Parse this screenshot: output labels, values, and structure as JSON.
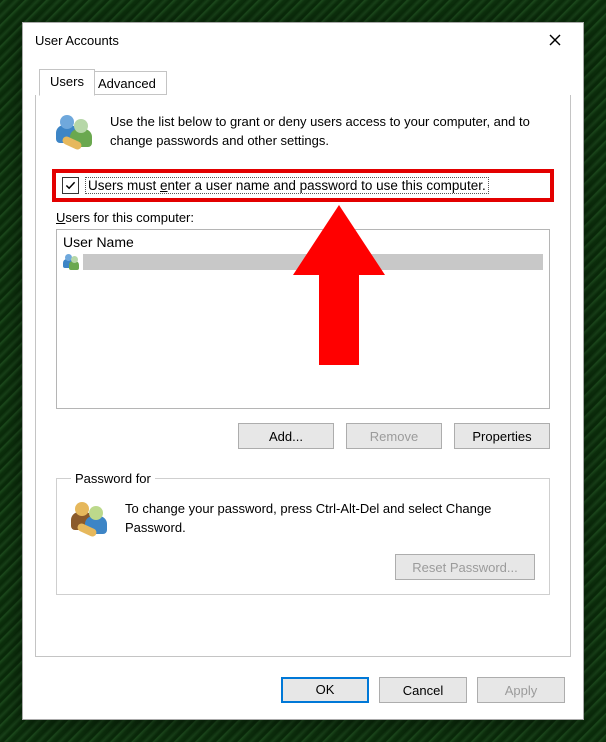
{
  "window": {
    "title": "User Accounts"
  },
  "tabs": {
    "users": "Users",
    "advanced": "Advanced"
  },
  "intro": {
    "text": "Use the list below to grant or deny users access to your computer, and to change passwords and other settings."
  },
  "checkbox": {
    "checked": true,
    "label_pre": "Users must ",
    "label_u": "e",
    "label_post": "nter a user name and password to use this computer."
  },
  "list": {
    "label_u": "U",
    "label_post": "sers for this computer:",
    "col1": "User Name"
  },
  "buttons": {
    "add": "Add...",
    "remove": "Remove",
    "properties": "Properties"
  },
  "password_group": {
    "legend": "Password for",
    "text": "To change your password, press Ctrl-Alt-Del and select Change Password.",
    "reset": "Reset Password..."
  },
  "footer": {
    "ok": "OK",
    "cancel": "Cancel",
    "apply": "Apply"
  }
}
